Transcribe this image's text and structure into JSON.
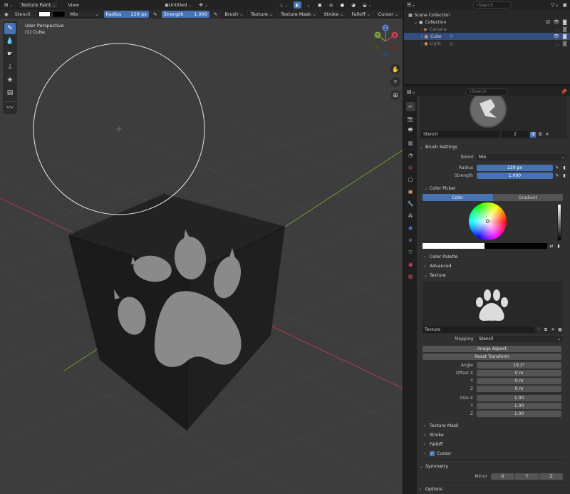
{
  "header": {
    "mode": "Texture Paint",
    "view_menu": "View",
    "file_name": "Untitled"
  },
  "toolbar": {
    "brush_mapping": "Stencil",
    "blend": "Mix",
    "radius_label": "Radius",
    "radius_value": "229 px",
    "strength_label": "Strength",
    "strength_value": "1.000",
    "menus": [
      "Brush",
      "Texture",
      "Texture Mask",
      "Stroke",
      "Falloff",
      "Cursor"
    ]
  },
  "viewport": {
    "perspective": "User Perspective",
    "object": "(1) Cube"
  },
  "gizmo": {
    "x": "X",
    "y": "Y",
    "z": "Z"
  },
  "outliner": {
    "search_placeholder": "Search",
    "rows": [
      {
        "label": "Scene Collection"
      },
      {
        "label": "Collection"
      },
      {
        "label": "Camera"
      },
      {
        "label": "Cube"
      },
      {
        "label": "Light"
      }
    ]
  },
  "properties": {
    "search_placeholder": "Search",
    "brush_name": "Stencil",
    "brush_users": "2",
    "brush_settings": "Brush Settings",
    "blend_label": "Blend",
    "blend_value": "Mix",
    "radius_label": "Radius",
    "radius_value": "229 px",
    "strength_label": "Strength",
    "strength_value": "1.000",
    "color_picker": "Color Picker",
    "tab_color": "Color",
    "tab_gradient": "Gradient",
    "color_palette": "Color Palette",
    "advanced": "Advanced",
    "texture": "Texture",
    "texture_name": "Texture",
    "mapping_label": "Mapping",
    "mapping_value": "Stencil",
    "image_aspect": "Image Aspect",
    "reset_transform": "Reset Transform",
    "angle_label": "Angle",
    "angle_value": "19.3°",
    "offset_x_label": "Offset X",
    "offset_x": "0 m",
    "offset_y_label": "Y",
    "offset_y": "0 m",
    "offset_z_label": "Z",
    "offset_z": "0 m",
    "size_x_label": "Size X",
    "size_x": "1.00",
    "size_y_label": "Y",
    "size_y": "1.00",
    "size_z_label": "Z",
    "size_z": "1.00",
    "texture_mask": "Texture Mask",
    "stroke": "Stroke",
    "falloff": "Falloff",
    "cursor": "Cursor",
    "symmetry": "Symmetry",
    "mirror_label": "Mirror",
    "mirror_x": "X",
    "mirror_y": "Y",
    "mirror_z": "Z",
    "options": "Options"
  },
  "colors": {
    "accent": "#4772b3",
    "viewport_bg": "#3d3d3d",
    "cube": "#1e1e1e",
    "paw": "#8a8a8a",
    "x_axis": "#b33b48",
    "y_axis": "#6e9a2e"
  }
}
